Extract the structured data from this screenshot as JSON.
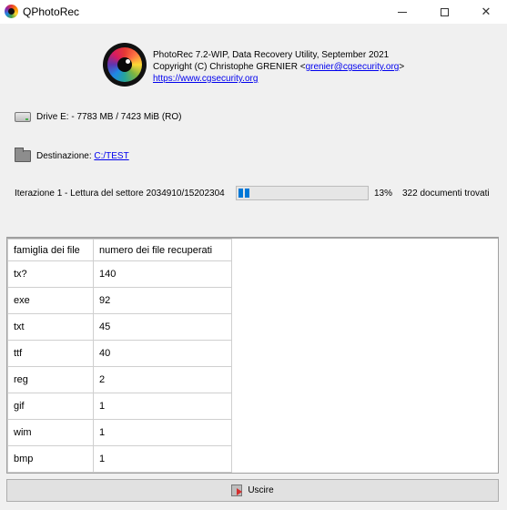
{
  "window": {
    "title": "QPhotoRec",
    "controls": {
      "minimize": "minimize-icon",
      "maximize": "maximize-icon",
      "close": "close-icon"
    }
  },
  "about": {
    "line1": "PhotoRec 7.2-WIP, Data Recovery Utility, September 2021",
    "line2_prefix": "Copyright (C) Christophe GRENIER <",
    "email": "grenier@cgsecurity.org",
    "line2_suffix": ">",
    "website": "https://www.cgsecurity.org"
  },
  "drive": {
    "label": "Drive E: - 7783 MB / 7423 MiB (RO)"
  },
  "destination": {
    "label": "Destinazione:",
    "path": "C:/TEST"
  },
  "status": {
    "iteration_text": "Iterazione 1 - Lettura del settore 2034910/15202304",
    "progress_percent": 13,
    "percent_label": "13%",
    "found_label": "322 documenti trovati",
    "accent_color": "#0078d7"
  },
  "table": {
    "headers": [
      "famiglia dei file",
      "numero dei file recuperati"
    ],
    "rows": [
      [
        "tx?",
        "140"
      ],
      [
        "exe",
        "92"
      ],
      [
        "txt",
        "45"
      ],
      [
        "ttf",
        "40"
      ],
      [
        "reg",
        "2"
      ],
      [
        "gif",
        "1"
      ],
      [
        "wim",
        "1"
      ],
      [
        "bmp",
        "1"
      ]
    ]
  },
  "buttons": {
    "quit_label": "Uscire"
  }
}
